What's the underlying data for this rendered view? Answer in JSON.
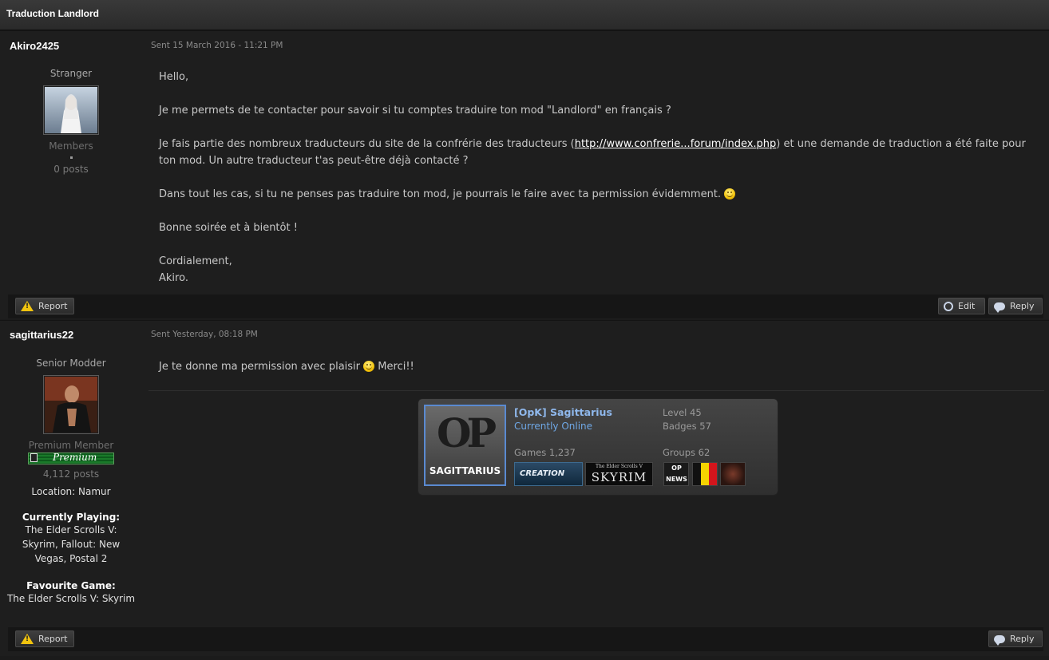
{
  "topic_title": "Traduction Landlord",
  "posts": [
    {
      "author": "Akiro2425",
      "date": "Sent 15 March 2016 - 11:21 PM",
      "rank": "Stranger",
      "group": "Members",
      "post_count": "0 posts",
      "paragraphs": {
        "p1": "Hello,",
        "p2": "Je me permets de te contacter pour savoir si tu comptes traduire ton mod \"Landlord\" en français ?",
        "p3_before": "Je fais partie des nombreux traducteurs du site de la confrérie des traducteurs (",
        "p3_link": "http://www.confrerie...forum/index.php",
        "p3_after": ") et une demande de traduction a été faite pour ton mod. Un autre traducteur t'as peut-être déjà contacté ?",
        "p4": "Dans tout les cas, si tu ne penses pas traduire ton mod, je pourrais le faire avec ta permission évidemment.",
        "p5": "Bonne soirée et à bientôt !",
        "p6a": "Cordialement,",
        "p6b": "Akiro."
      },
      "buttons": {
        "report": "Report",
        "edit": "Edit",
        "reply": "Reply"
      }
    },
    {
      "author": "sagittarius22",
      "date": "Sent Yesterday, 08:18 PM",
      "rank": "Senior Modder",
      "group": "Premium Member",
      "badge": "Premium",
      "post_count": "4,112 posts",
      "location": "Location: Namur",
      "playing_label": "Currently Playing:",
      "playing_value": "The Elder Scrolls V: Skyrim, Fallout: New Vegas, Postal 2",
      "fav_label": "Favourite Game:",
      "fav_value": "The Elder Scrolls V: Skyrim",
      "message_before": "Je te donne ma permission avec plaisir",
      "message_after": "Merci!!",
      "buttons": {
        "report": "Report",
        "reply": "Reply"
      }
    }
  ],
  "steam_card": {
    "name": "[OpK] Sagittarius",
    "status": "Currently Online",
    "avatar_text": "SAGITTARIUS",
    "avatar_logo": "OP",
    "level": "Level 45",
    "badges": "Badges 57",
    "games": "Games 1,237",
    "groups": "Groups 62",
    "game_tiles": [
      "CREATION",
      "SKYRIM"
    ],
    "skyrim_sub": "The Elder Scrolls V",
    "group_tiles": [
      "OP NEWS"
    ],
    "colors": {
      "accent": "#5a8ad1",
      "name": "#8fb8ec"
    }
  }
}
